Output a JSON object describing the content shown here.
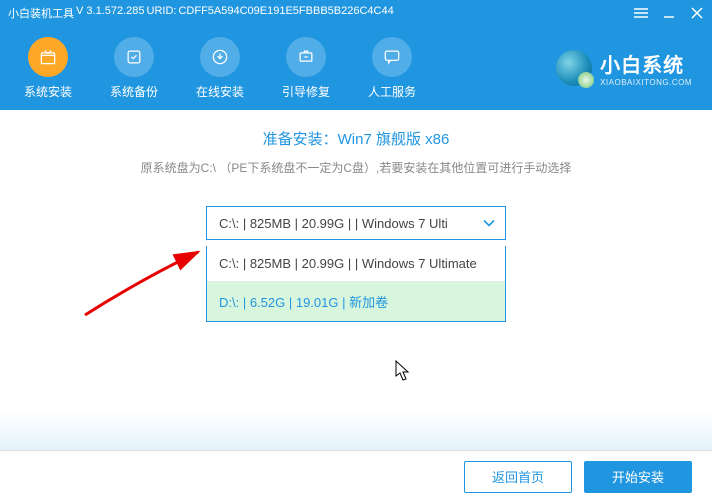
{
  "titlebar": {
    "app_name": "小白装机工具",
    "version": "V 3.1.572.285",
    "urid_label": "URID:",
    "urid_value": "CDFF5A594C09E191E5FBBB5B226C4C44"
  },
  "nav": {
    "items": [
      {
        "label": "系统安装",
        "active": true
      },
      {
        "label": "系统备份",
        "active": false
      },
      {
        "label": "在线安装",
        "active": false
      },
      {
        "label": "引导修复",
        "active": false
      },
      {
        "label": "人工服务",
        "active": false
      }
    ]
  },
  "brand": {
    "title": "小白系统",
    "subtitle": "XIAOBAIXITONG.COM"
  },
  "main": {
    "title": "准备安装：Win7 旗舰版 x86",
    "note": "原系统盘为C:\\ （PE下系统盘不一定为C盘）,若要安装在其他位置可进行手动选择",
    "selected": "C:\\: | 825MB | 20.99G |  | Windows 7 Ulti",
    "options": [
      {
        "text": "C:\\: | 825MB | 20.99G |  | Windows 7 Ultimate",
        "highlighted": false
      },
      {
        "text": "D:\\: | 6.52G | 19.01G | 新加卷",
        "highlighted": true
      }
    ]
  },
  "footer": {
    "back_label": "返回首页",
    "start_label": "开始安装"
  }
}
